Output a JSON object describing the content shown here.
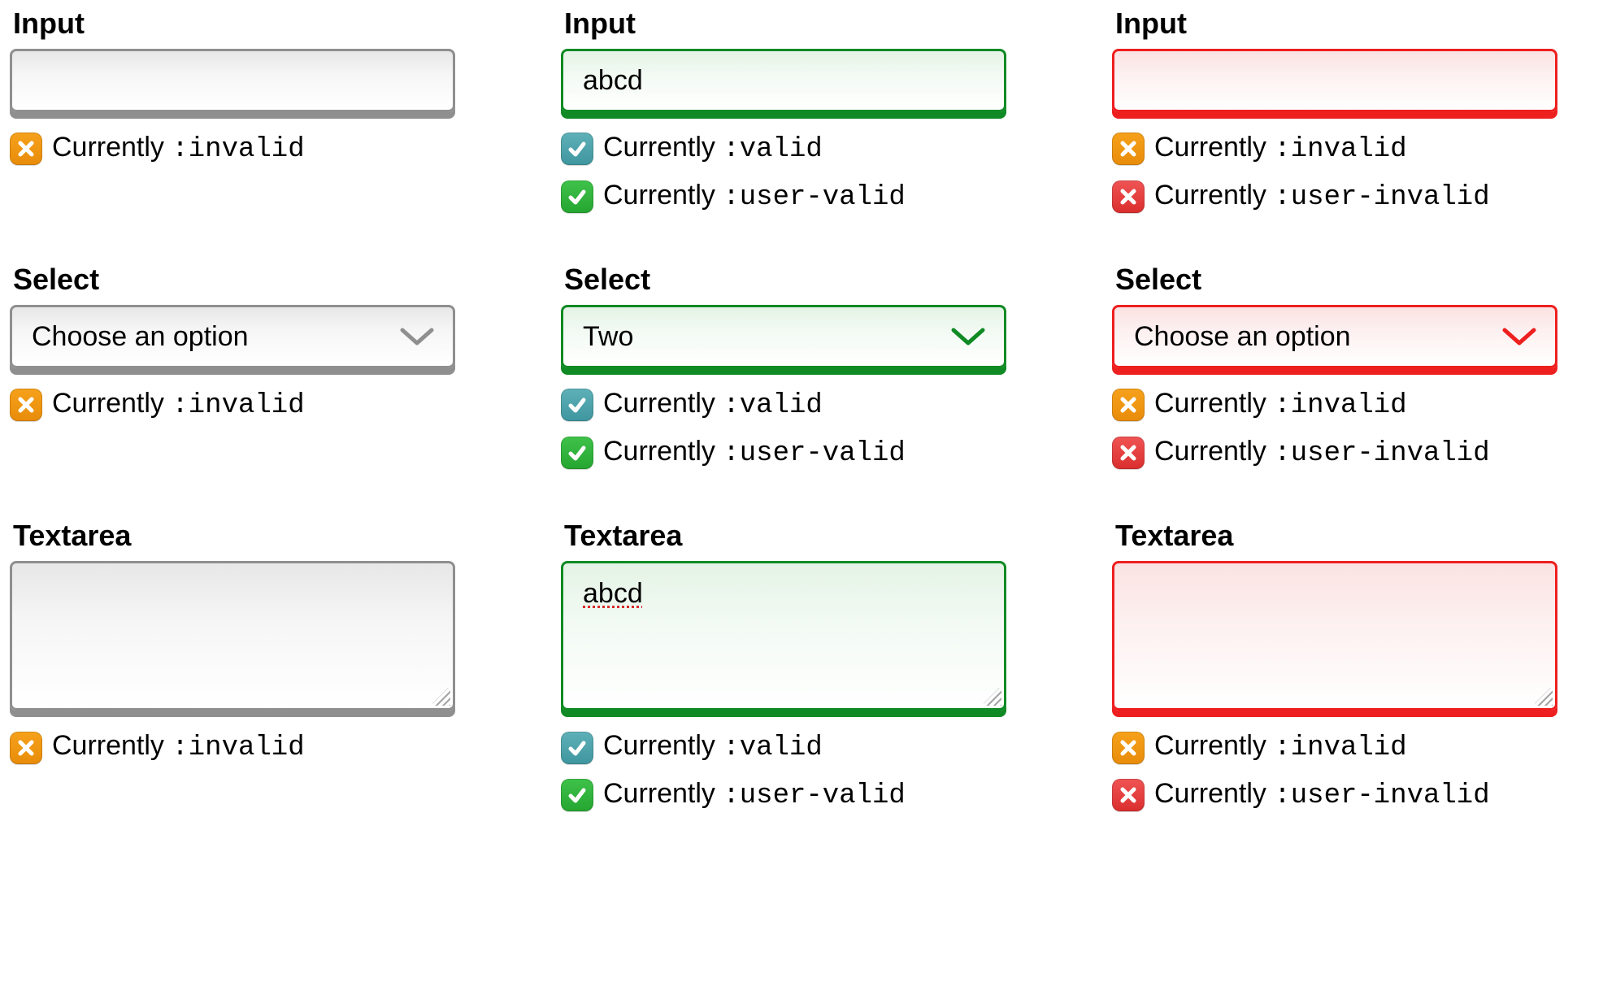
{
  "labels": {
    "input": "Input",
    "select": "Select",
    "textarea": "Textarea"
  },
  "status": {
    "prefix": "Currently ",
    "invalid": ":invalid",
    "valid": ":valid",
    "user_valid": ":user-valid",
    "user_invalid": ":user-invalid"
  },
  "columns": {
    "neutral": {
      "input_value": "",
      "select_value": "Choose an option",
      "textarea_value": "",
      "statuses": {
        "input": [
          {
            "kind": "invalid",
            "badge": "orange"
          }
        ],
        "select": [
          {
            "kind": "invalid",
            "badge": "orange"
          }
        ],
        "textarea": [
          {
            "kind": "invalid",
            "badge": "orange"
          }
        ]
      }
    },
    "valid": {
      "input_value": "abcd",
      "select_value": "Two",
      "textarea_value": "abcd",
      "statuses": {
        "input": [
          {
            "kind": "valid",
            "badge": "teal"
          },
          {
            "kind": "user_valid",
            "badge": "green"
          }
        ],
        "select": [
          {
            "kind": "valid",
            "badge": "teal"
          },
          {
            "kind": "user_valid",
            "badge": "green"
          }
        ],
        "textarea": [
          {
            "kind": "valid",
            "badge": "teal"
          },
          {
            "kind": "user_valid",
            "badge": "green"
          }
        ]
      }
    },
    "invalid": {
      "input_value": "",
      "select_value": "Choose an option",
      "textarea_value": "",
      "statuses": {
        "input": [
          {
            "kind": "invalid",
            "badge": "orange"
          },
          {
            "kind": "user_invalid",
            "badge": "red"
          }
        ],
        "select": [
          {
            "kind": "invalid",
            "badge": "orange"
          },
          {
            "kind": "user_invalid",
            "badge": "red"
          }
        ],
        "textarea": [
          {
            "kind": "invalid",
            "badge": "orange"
          },
          {
            "kind": "user_invalid",
            "badge": "red"
          }
        ]
      }
    }
  },
  "colors": {
    "neutral": "#8f8f8f",
    "valid": "#0f8a24",
    "invalid": "#ee1f1f"
  }
}
